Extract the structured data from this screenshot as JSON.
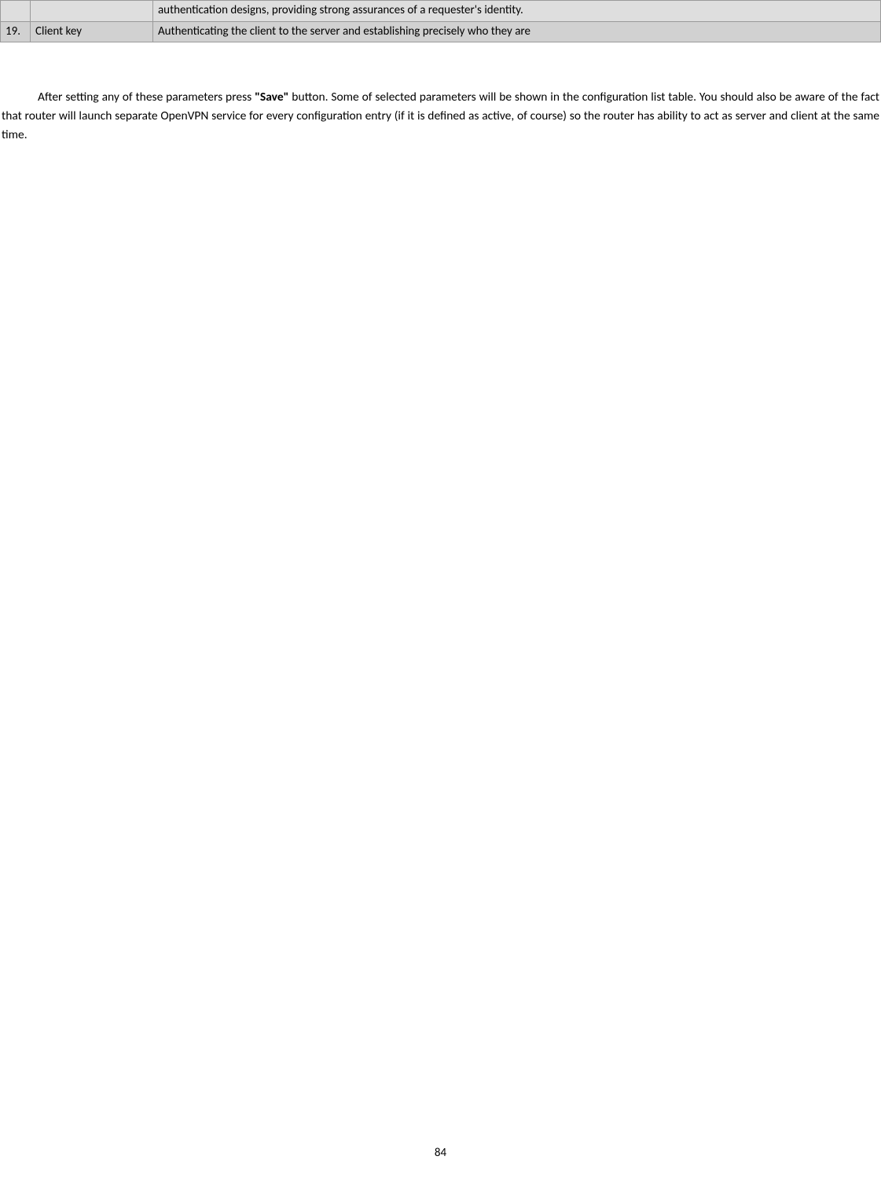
{
  "table": {
    "rows": [
      {
        "num": "",
        "name": "",
        "desc": "authentication designs, providing strong assurances of a requester's identity."
      },
      {
        "num": "19.",
        "name": "Client key",
        "desc": "Authenticating the client to the server and establishing precisely who they are"
      }
    ]
  },
  "paragraph": {
    "part1": "After setting any of these parameters press ",
    "bold": "\"Save\"",
    "part2": " button. Some of selected parameters will be shown in the configuration list table. You should also be aware of the fact that router will launch separate OpenVPN service for every configuration entry (if it is defined as active, of course) so the router has ability to act as server and client at the same time."
  },
  "pageNumber": "84"
}
